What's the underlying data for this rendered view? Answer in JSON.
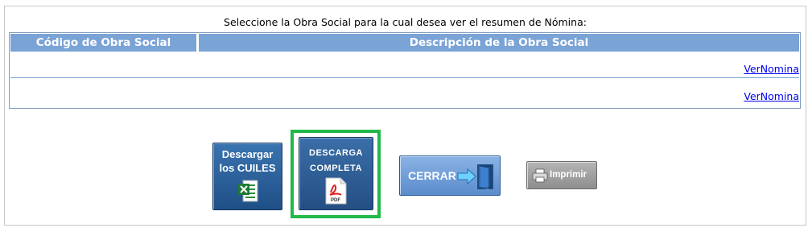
{
  "prompt": "Seleccione la Obra Social para la cual desea ver el resumen de Nómina:",
  "table": {
    "headers": [
      "Código de Obra Social",
      "Descripción de la Obra Social"
    ],
    "rows": [
      {
        "code": "",
        "description": "",
        "link": "VerNomina"
      },
      {
        "code": "",
        "description": "",
        "link": "VerNomina"
      }
    ]
  },
  "buttons": {
    "download_cuiles": {
      "line1": "Descargar",
      "line2": "los CUILES",
      "icon": "excel-icon"
    },
    "download_complete": {
      "line1": "DESCARGA",
      "line2": "COMPLETA",
      "icon_text": "PDF",
      "icon": "pdf-icon"
    },
    "close": {
      "label": "CERRAR",
      "icon": "exit-door-icon"
    },
    "print": {
      "label": "Imprimir",
      "icon": "printer-icon"
    }
  },
  "colors": {
    "header_bg": "#7aa3d6",
    "button_dark_blue": "#2a5a93",
    "button_light_blue": "#6f9fd9",
    "highlight": "#22b84a",
    "link": "#0000ee"
  }
}
